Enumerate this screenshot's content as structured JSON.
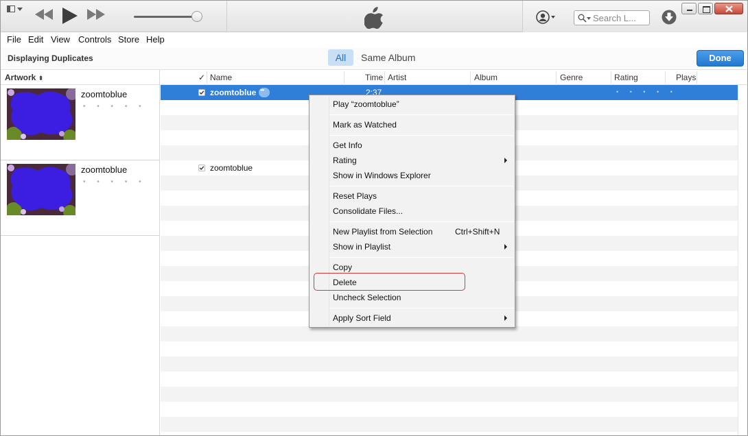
{
  "toolbar": {
    "search_placeholder": "Search L...",
    "icons": [
      "sidebar-toggle-icon",
      "rewind-icon",
      "play-icon",
      "fast-forward-icon",
      "apple-logo-icon",
      "account-icon",
      "search-icon",
      "download-icon"
    ],
    "volume_level": 0.95
  },
  "menu": {
    "file": "File",
    "edit": "Edit",
    "view": "View",
    "controls": "Controls",
    "store": "Store",
    "help": "Help"
  },
  "header": {
    "title": "Displaying Duplicates",
    "tab_all": "All",
    "tab_same_album": "Same Album",
    "done_label": "Done"
  },
  "columns": {
    "artwork": "Artwork",
    "check": "✓",
    "name": "Name",
    "time": "Time",
    "artist": "Artist",
    "album": "Album",
    "genre": "Genre",
    "rating": "Rating",
    "plays": "Plays"
  },
  "groups": [
    {
      "title": "zoomtoblue",
      "rating_dots": "• • • • •",
      "track_name": "zoomtoblue",
      "time": "2:37",
      "rating_dots_row": "• • • • •"
    },
    {
      "title": "zoomtoblue",
      "rating_dots": "• • • • •",
      "track_name": "zoomtoblue"
    }
  ],
  "context_menu": {
    "play": "Play “zoomtoblue”",
    "mark_watched": "Mark as Watched",
    "get_info": "Get Info",
    "rating": "Rating",
    "show_explorer": "Show in Windows Explorer",
    "reset_plays": "Reset Plays",
    "consolidate": "Consolidate Files...",
    "new_playlist": "New Playlist from Selection",
    "new_playlist_shortcut": "Ctrl+Shift+N",
    "show_in_playlist": "Show in Playlist",
    "copy": "Copy",
    "delete": "Delete",
    "uncheck": "Uncheck Selection",
    "apply_sort": "Apply Sort Field"
  },
  "colors": {
    "selection": "#2f7fd8",
    "done_button": "#2279d2",
    "highlight_ring": "#d43a3a",
    "segment_active": "#c8dff5"
  }
}
